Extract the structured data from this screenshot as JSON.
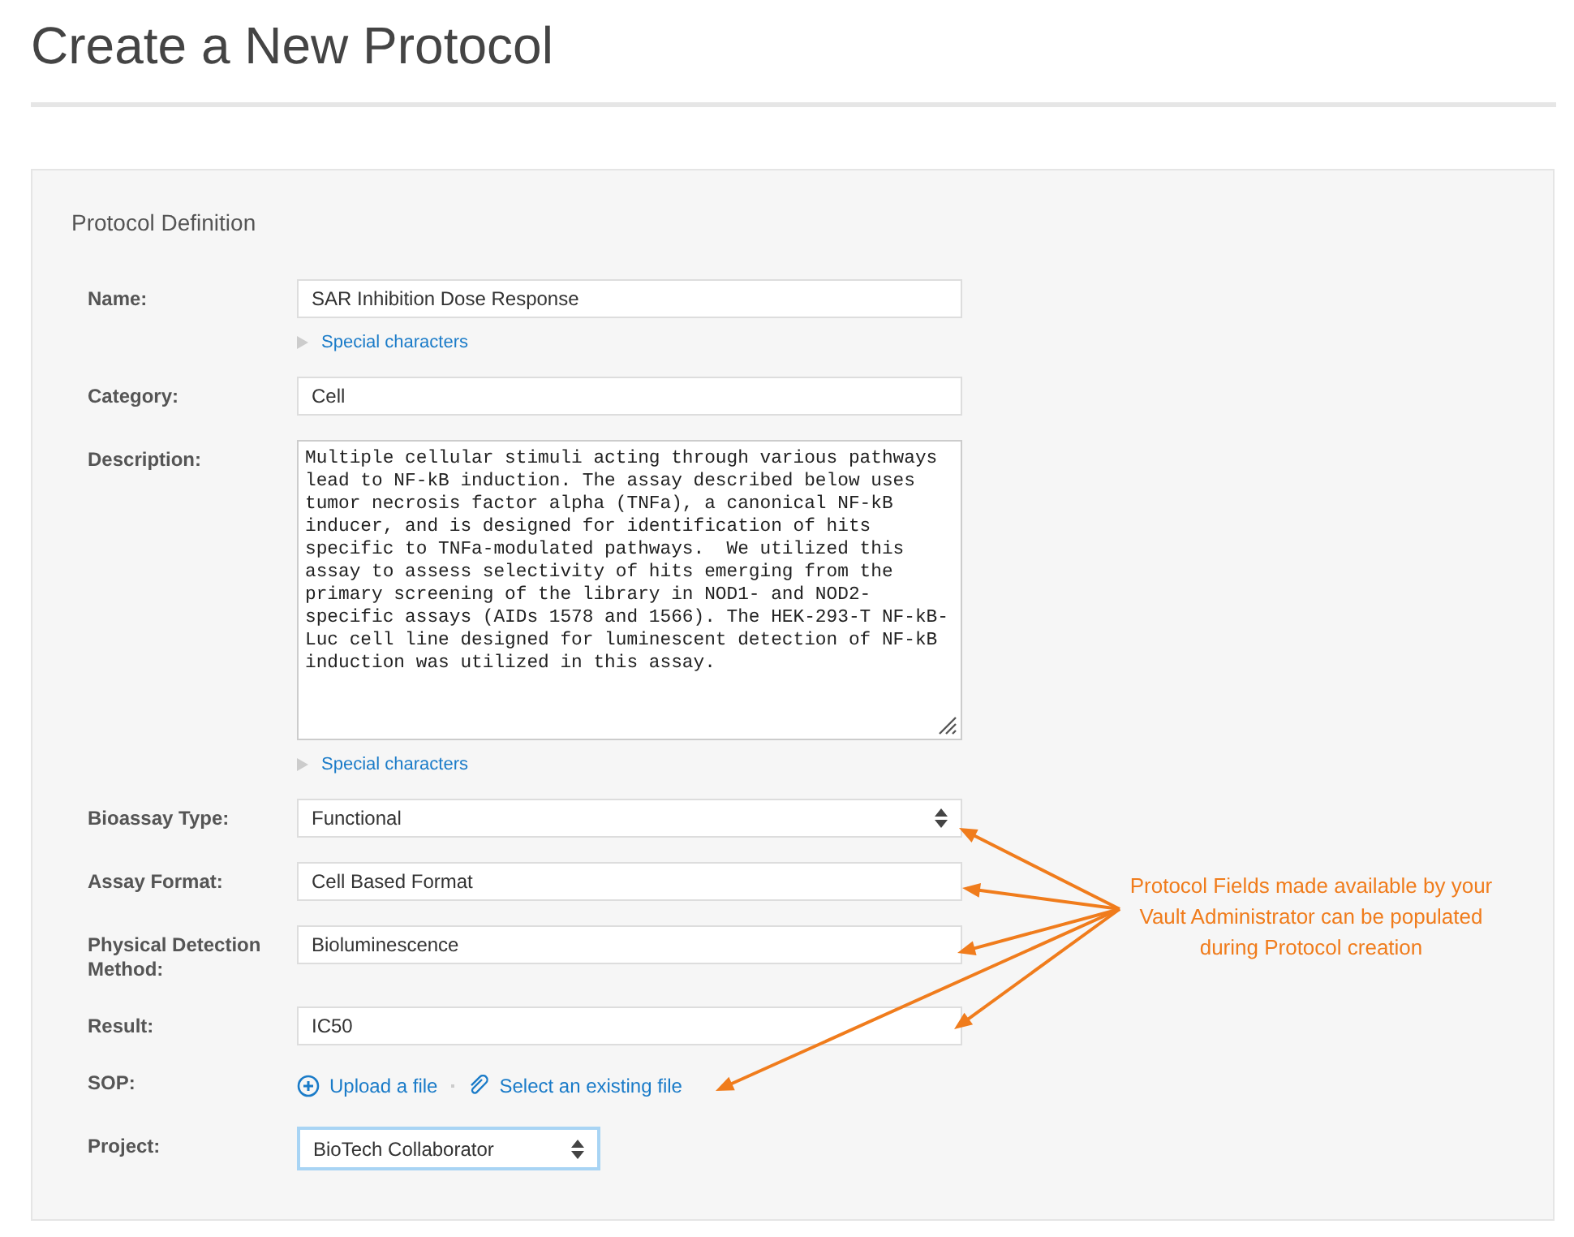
{
  "page_title": "Create a New Protocol",
  "section_title": "Protocol Definition",
  "fields": [
    {
      "kind": "text",
      "label": "Name:",
      "value": "SAR Inhibition Dose Response",
      "link": "Special characters"
    },
    {
      "kind": "text",
      "label": "Category:",
      "value": "Cell"
    },
    {
      "kind": "textarea",
      "label": "Description:",
      "value": "Multiple cellular stimuli acting through various pathways lead to NF-kB induction. The assay described below uses tumor necrosis factor alpha (TNFa), a canonical NF-kB inducer, and is designed for identification of hits specific to TNFa-modulated pathways.  We utilized this assay to assess selectivity of hits emerging from the primary screening of the library in NOD1- and NOD2-specific assays (AIDs 1578 and 1566). The HEK-293-T NF-kB-Luc cell line designed for luminescent detection of NF-kB induction was utilized in this assay.",
      "link": "Special characters"
    },
    {
      "kind": "select",
      "label": "Bioassay Type:",
      "value": "Functional",
      "focused": false
    },
    {
      "kind": "text",
      "label": "Assay Format:",
      "value": "Cell Based Format"
    },
    {
      "kind": "text",
      "label": "Physical Detection Method:",
      "value": "Bioluminescence"
    },
    {
      "kind": "text",
      "label": "Result:",
      "value": "IC50"
    },
    {
      "kind": "file",
      "label": "SOP:",
      "upload": "Upload a file",
      "select": "Select an existing file"
    },
    {
      "kind": "select",
      "label": "Project:",
      "value": "BioTech Collaborator",
      "focused": true,
      "short": true
    }
  ],
  "annotation": {
    "text": "Protocol Fields made available by your Vault Administrator can be populated during Protocol creation"
  }
}
